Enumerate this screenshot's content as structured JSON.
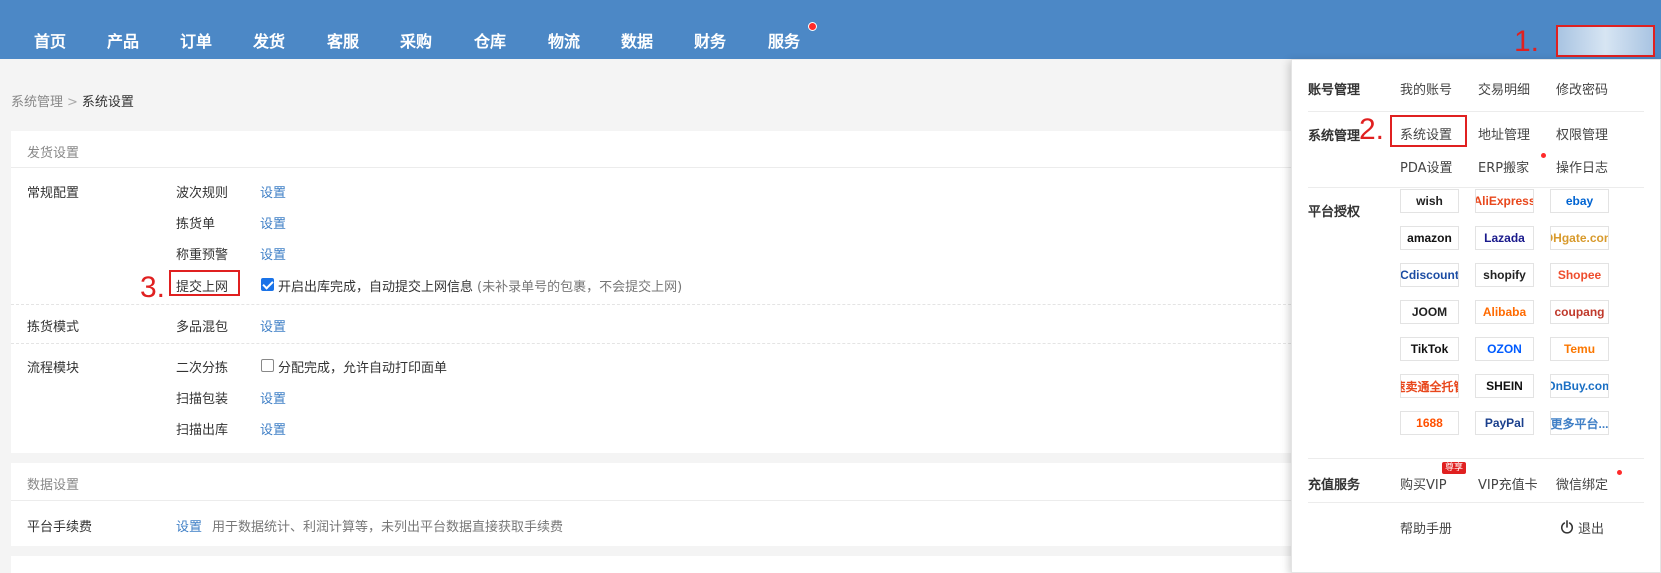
{
  "nav": {
    "items": [
      "首页",
      "产品",
      "订单",
      "发货",
      "客服",
      "采购",
      "仓库",
      "物流",
      "数据",
      "财务",
      "服务"
    ],
    "accent": "#4c88c6",
    "dot_color": "#ff2a2a"
  },
  "annotations": {
    "a1": "1.",
    "a2": "2.",
    "a3": "3."
  },
  "breadcrumb": {
    "parent": "系统管理",
    "separator": ">",
    "current": "系统设置"
  },
  "shipping": {
    "title": "发货设置",
    "general_label": "常规配置",
    "wave_rule": "波次规则",
    "pick_list": "拣货单",
    "weigh_warn": "称重预警",
    "submit_online": "提交上网",
    "submit_online_checked": true,
    "submit_online_desc": "开启出库完成，自动提交上网信息",
    "submit_online_note": "(未补录单号的包裹，不会提交上网)",
    "pick_mode_label": "拣货模式",
    "multi_mix": "多品混包",
    "flow_label": "流程模块",
    "second_sort": "二次分拣",
    "second_sort_checked": false,
    "second_sort_desc": "分配完成，允许自动打印面单",
    "scan_pack": "扫描包装",
    "scan_out": "扫描出库",
    "set_link": "设置"
  },
  "data_settings": {
    "title": "数据设置",
    "fee_label": "平台手续费",
    "set_link": "设置",
    "fee_desc": "用于数据统计、利润计算等，未列出平台数据直接获取手续费"
  },
  "dropdown": {
    "account_head": "账号管理",
    "my_account": "我的账号",
    "transactions": "交易明细",
    "change_password": "修改密码",
    "system_head": "系统管理",
    "system_settings": "系统设置",
    "address_mgmt": "地址管理",
    "permission_mgmt": "权限管理",
    "pda_settings": "PDA设置",
    "erp_move": "ERP搬家",
    "op_log": "操作日志",
    "platform_head": "平台授权",
    "platforms": [
      {
        "name": "wish",
        "color": "#222222"
      },
      {
        "name": "AliExpress",
        "color": "#e8471c"
      },
      {
        "name": "ebay",
        "color": "#0064d2"
      },
      {
        "name": "amazon",
        "color": "#111111"
      },
      {
        "name": "Lazada",
        "color": "#1a1a8c"
      },
      {
        "name": "DHgate.com",
        "color": "#d89a2c"
      },
      {
        "name": "Cdiscount",
        "color": "#1b4ca3"
      },
      {
        "name": "shopify",
        "color": "#222222"
      },
      {
        "name": "Shopee",
        "color": "#ee4d2d"
      },
      {
        "name": "JOOM",
        "color": "#222222"
      },
      {
        "name": "Alibaba",
        "color": "#ff6a00"
      },
      {
        "name": "coupang",
        "color": "#c0392b"
      },
      {
        "name": "TikTok",
        "color": "#111111"
      },
      {
        "name": "OZON",
        "color": "#005bff"
      },
      {
        "name": "Temu",
        "color": "#fb7701"
      },
      {
        "name": "速卖通全托管",
        "color": "#e8471c"
      },
      {
        "name": "SHEIN",
        "color": "#111111"
      },
      {
        "name": "OnBuy.com",
        "color": "#1a6fc4"
      },
      {
        "name": "1688",
        "color": "#ff5000"
      },
      {
        "name": "PayPal",
        "color": "#1a3f8c"
      },
      {
        "name": "更多平台...",
        "color": "#3f7fc6"
      }
    ],
    "recharge_head": "充值服务",
    "buy_vip": "购买VIP",
    "vip_badge": "尊享",
    "vip_card": "VIP充值卡",
    "wechat_bind": "微信绑定",
    "help": "帮助手册",
    "logout": "退出"
  }
}
